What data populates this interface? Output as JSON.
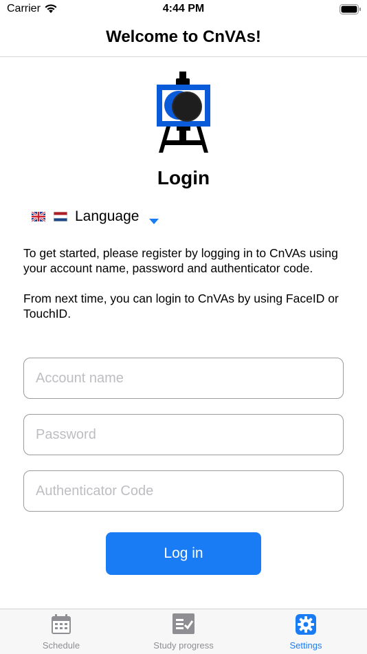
{
  "status_bar": {
    "carrier": "Carrier",
    "time": "4:44 PM"
  },
  "nav": {
    "title": "Welcome to CnVAs!"
  },
  "login": {
    "heading": "Login",
    "language_label": "Language",
    "intro_paragraphs": [
      "To get started, please register by logging in to CnVAs using your account name, password and authenticator code.",
      "From next time, you can login to CnVAs by using FaceID or TouchID."
    ],
    "fields": {
      "account_placeholder": "Account name",
      "password_placeholder": "Password",
      "authenticator_placeholder": "Authenticator Code"
    },
    "button_label": "Log in"
  },
  "tab_bar": {
    "tabs": [
      {
        "label": "Schedule",
        "icon": "calendar-icon",
        "active": false
      },
      {
        "label": "Study progress",
        "icon": "checklist-icon",
        "active": false
      },
      {
        "label": "Settings",
        "icon": "gear-icon",
        "active": true
      }
    ]
  },
  "colors": {
    "accent": "#1a7cf5",
    "logo_blue": "#0a5bd9",
    "inactive_tab": "#8e8e93"
  }
}
